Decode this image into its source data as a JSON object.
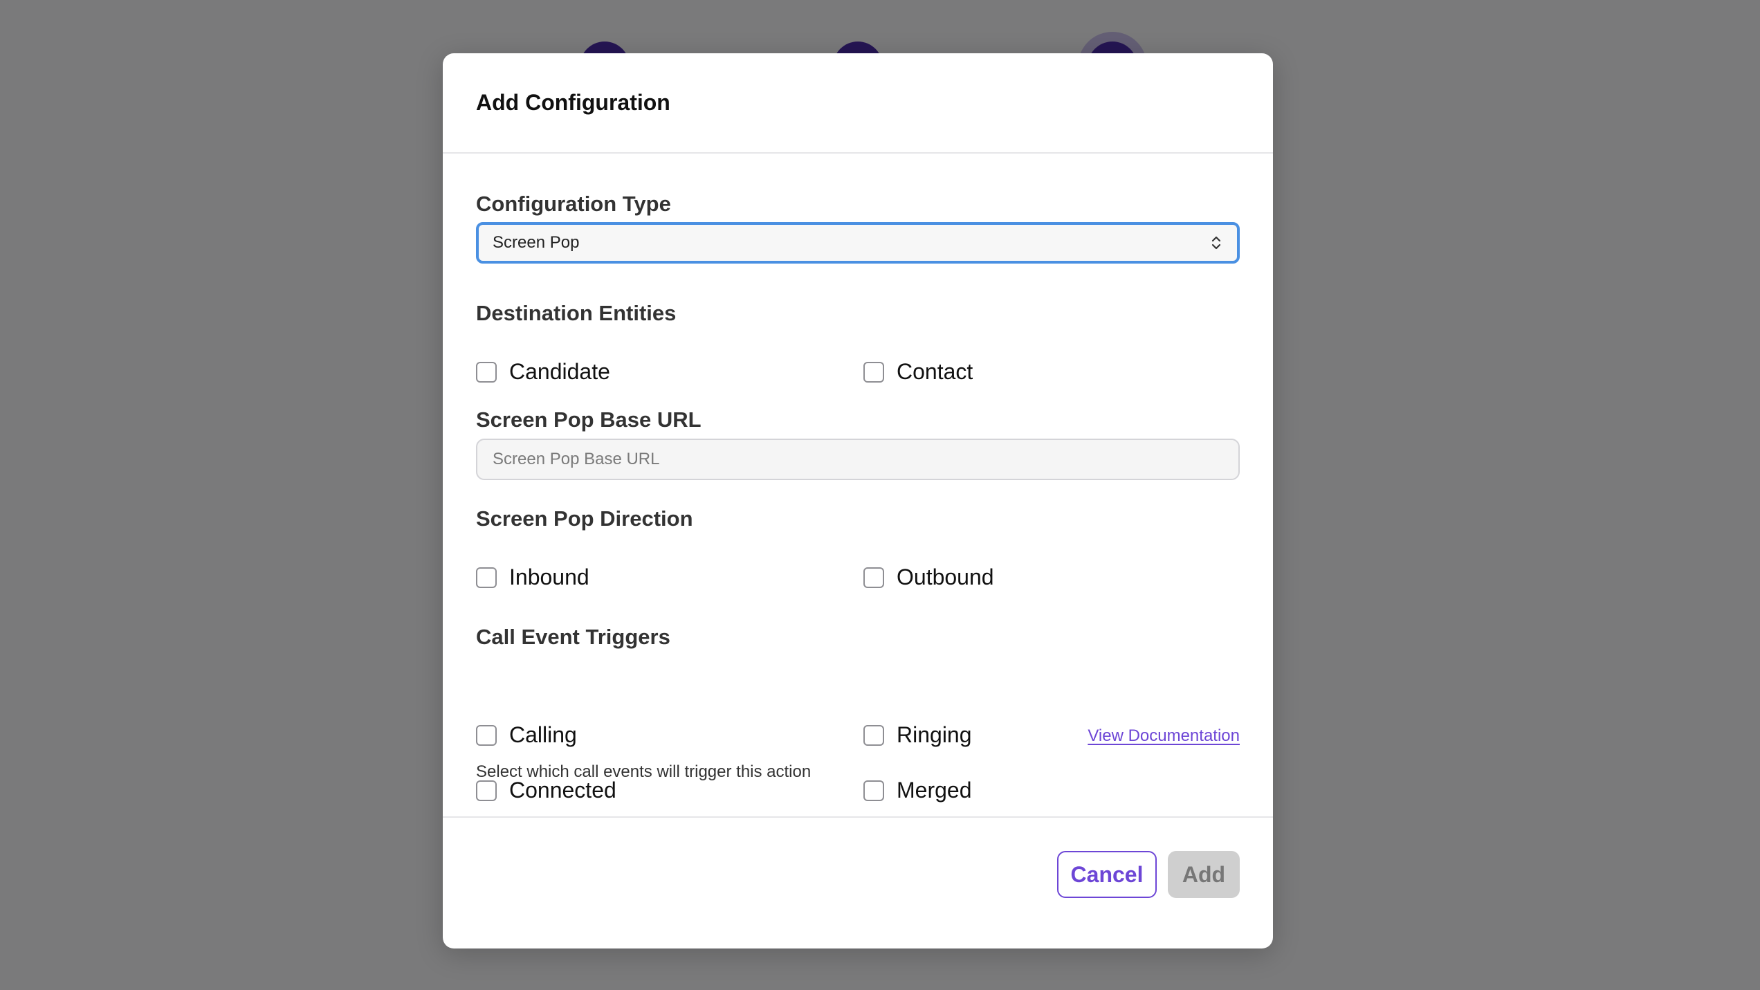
{
  "modal": {
    "title": "Add Configuration",
    "configuration_type": {
      "label": "Configuration Type",
      "selected": "Screen Pop"
    },
    "destination_entities": {
      "label": "Destination Entities",
      "options": [
        "Candidate",
        "Contact"
      ]
    },
    "base_url": {
      "label": "Screen Pop Base URL",
      "placeholder": "Screen Pop Base URL",
      "value": ""
    },
    "direction": {
      "label": "Screen Pop Direction",
      "options": [
        "Inbound",
        "Outbound"
      ]
    },
    "call_event_triggers": {
      "label": "Call Event Triggers",
      "link": "View Documentation",
      "help": "Select which call events will trigger this action",
      "options": [
        "Calling",
        "Ringing",
        "Connected",
        "Merged"
      ]
    },
    "buttons": {
      "cancel": "Cancel",
      "add": "Add"
    }
  },
  "colors": {
    "accent": "#6d46d6",
    "focus_border": "#4a90e2",
    "disabled_button": "#cfcfcf",
    "stepper": "#4b2aa6"
  }
}
